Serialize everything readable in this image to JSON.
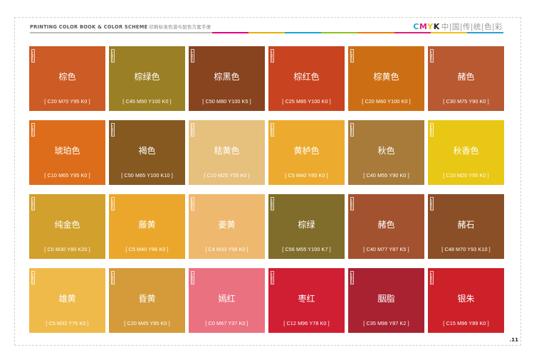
{
  "header": {
    "title_en": "PRINTING COLOR BOOK & COLOR SCHEME",
    "title_cn": "印刷标准色谱与配色方案手册",
    "brand_c": "C",
    "brand_m": "M",
    "brand_y": "Y",
    "brand_k": "K",
    "brand_cn": "中|国|传|统|色|彩",
    "line_colors": [
      "#e5007f",
      "#e3b300",
      "#1aa6d6",
      "#8dc21f",
      "#ef7d00",
      "#d9217c",
      "#e8c21c",
      "#2b9fd4"
    ]
  },
  "badge_text": "中国色彩",
  "swatches": [
    {
      "name": "棕色",
      "code": "[ C20 M70 Y95 K0 ]",
      "color": "#cc5b25"
    },
    {
      "name": "棕绿色",
      "code": "[ C45 M50 Y100 K0 ]",
      "color": "#9a7f24"
    },
    {
      "name": "棕黑色",
      "code": "[ C50 M80 Y100 K5 ]",
      "color": "#87441f"
    },
    {
      "name": "棕红色",
      "code": "[ C25 M85 Y100 K0 ]",
      "color": "#c84420"
    },
    {
      "name": "棕黄色",
      "code": "[ C20 M60 Y100 K0 ]",
      "color": "#cc6f14"
    },
    {
      "name": "赭色",
      "code": "[ C30 M75 Y90 K0 ]",
      "color": "#b85932"
    },
    {
      "name": "琥珀色",
      "code": "[ C10 M65 Y95 K0 ]",
      "color": "#dd6d1b"
    },
    {
      "name": "褐色",
      "code": "[ C50 M65 Y100 K10 ]",
      "color": "#865921"
    },
    {
      "name": "秸黄色",
      "code": "[ C10 M25 Y55 K0 ]",
      "color": "#e6c07d"
    },
    {
      "name": "黄栌色",
      "code": "[ C5 M40 Y85 K0 ]",
      "color": "#ecab2f"
    },
    {
      "name": "秋色",
      "code": "[ C40 M55 Y90 K0 ]",
      "color": "#a87b3a"
    },
    {
      "name": "秋香色",
      "code": "[ C10 M20 Y95 K0 ]",
      "color": "#e9c715"
    },
    {
      "name": "纯金色",
      "code": "[ C0 M30 Y80 K20 ]",
      "color": "#d2a02d"
    },
    {
      "name": "藤黄",
      "code": "[ C5 M40 Y86 K0 ]",
      "color": "#eba72c"
    },
    {
      "name": "姜黄",
      "code": "[ C4 M33 Y58 K0 ]",
      "color": "#eeb86e"
    },
    {
      "name": "棕绿",
      "code": "[ C56 M55 Y100 K7 ]",
      "color": "#816d2b"
    },
    {
      "name": "赭色",
      "code": "[ C40 M77 Y87 K5 ]",
      "color": "#a3522f"
    },
    {
      "name": "赭石",
      "code": "[ C48 M70 Y93 K10 ]",
      "color": "#8a4f26"
    },
    {
      "name": "雄黄",
      "code": "[ C5 M32 Y75 K0 ]",
      "color": "#efba4a"
    },
    {
      "name": "昏黄",
      "code": "[ C20 M45 Y85 K0 ]",
      "color": "#d59b3b"
    },
    {
      "name": "嫣红",
      "code": "[ C0 M67 Y37 K0 ]",
      "color": "#ea7180"
    },
    {
      "name": "枣红",
      "code": "[ C12 M96 Y78 K0 ]",
      "color": "#d01e33"
    },
    {
      "name": "胭脂",
      "code": "[ C35 M98 Y87 K2 ]",
      "color": "#a82231"
    },
    {
      "name": "银朱",
      "code": "[ C15 M96 Y89 K0 ]",
      "color": "#cc2128"
    }
  ],
  "page_number": ".11"
}
